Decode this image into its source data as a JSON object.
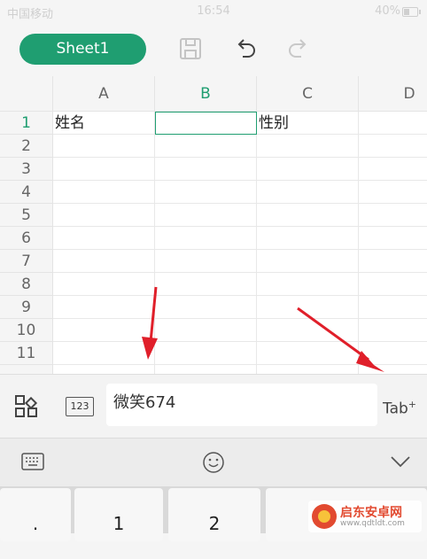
{
  "status_bar": {
    "carrier": "中国移动",
    "time": "16:54",
    "battery": "40%"
  },
  "toolbar": {
    "sheet_label": "Sheet1",
    "save_icon": "floppy-disk-icon",
    "undo_icon": "undo-icon",
    "redo_icon": "redo-icon"
  },
  "sheet": {
    "columns": [
      "A",
      "B",
      "C",
      "D"
    ],
    "rows": [
      "1",
      "2",
      "3",
      "4",
      "5",
      "6",
      "7",
      "8",
      "9",
      "10",
      "11"
    ],
    "cells": {
      "A1": "姓名",
      "B1": "",
      "C1": "性别"
    },
    "selected_cell": "B1"
  },
  "input_bar": {
    "value": "微笑674",
    "numeric_label": "123",
    "tab_label": "Tab"
  },
  "keyboard": {
    "keys": [
      ".",
      "1",
      "2"
    ]
  },
  "watermark": {
    "title": "启东安卓网",
    "url": "www.qdtldt.com"
  },
  "colors": {
    "accent": "#1f9e71",
    "arrow": "#e01f2a"
  }
}
